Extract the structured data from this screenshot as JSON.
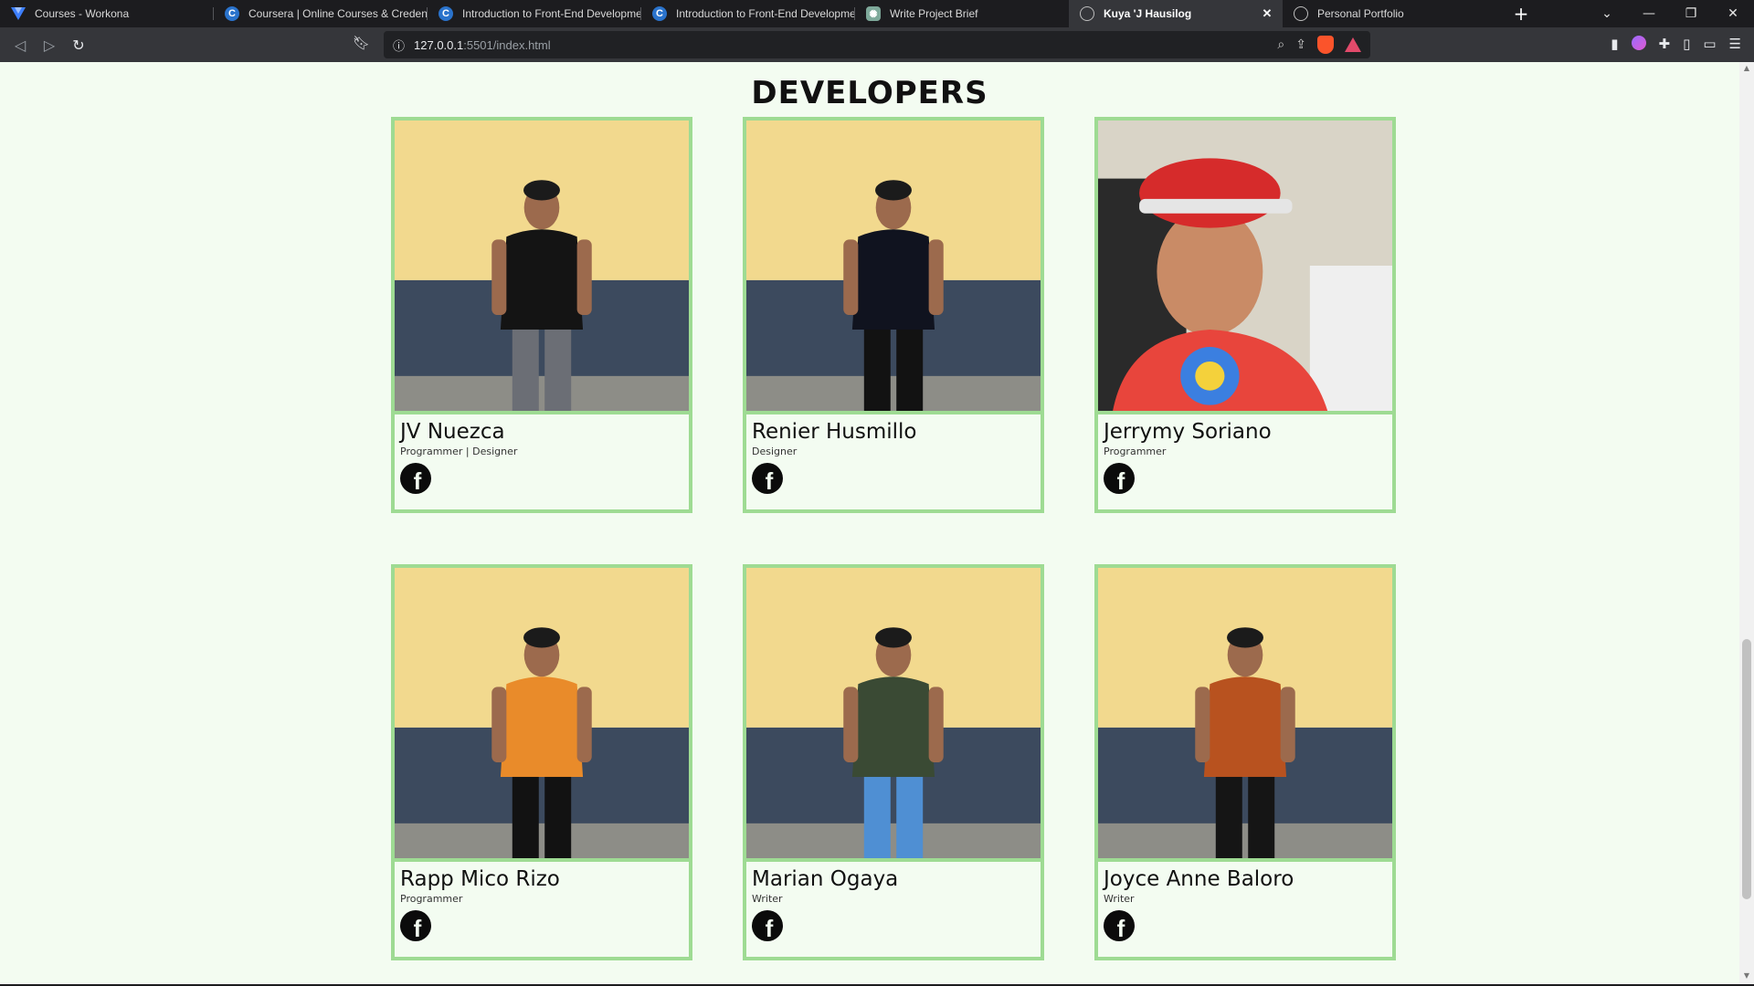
{
  "browser": {
    "tabs": [
      {
        "title": "Courses - Workona",
        "favicon": "workona-icon",
        "active": false
      },
      {
        "title": "Coursera | Online Courses & Credentials",
        "favicon": "coursera-icon",
        "active": false
      },
      {
        "title": "Introduction to Front-End Development",
        "favicon": "coursera-icon",
        "active": false
      },
      {
        "title": "Introduction to Front-End Development",
        "favicon": "coursera-icon",
        "active": false
      },
      {
        "title": "Write Project Brief",
        "favicon": "openai-icon",
        "active": false
      },
      {
        "title": "Kuya 'J Hausilog",
        "favicon": "globe-icon",
        "active": true
      },
      {
        "title": "Personal Portfolio",
        "favicon": "globe-icon",
        "active": false
      }
    ],
    "url_host": "127.0.0.1",
    "url_path": ":5501/index.html"
  },
  "page": {
    "section_title": "DEVELOPERS",
    "developers": [
      {
        "name": "JV Nuezca",
        "role": "Programmer | Designer",
        "shirt": "#141414",
        "pants": "#6b6e75"
      },
      {
        "name": "Renier Husmillo",
        "role": "Designer",
        "shirt": "#10131f",
        "pants": "#121212"
      },
      {
        "name": "Jerrymy Soriano",
        "role": "Programmer",
        "shirt": "#e8453c",
        "pants": "#121212"
      },
      {
        "name": "Rapp Mico Rizo",
        "role": "Programmer",
        "shirt": "#e98b2a",
        "pants": "#121212"
      },
      {
        "name": "Marian Ogaya",
        "role": "Writer",
        "shirt": "#3a4a34",
        "pants": "#4f8fd3"
      },
      {
        "name": "Joyce Anne Baloro",
        "role": "Writer",
        "shirt": "#b8521f",
        "pants": "#151515"
      }
    ]
  },
  "colors": {
    "page_bg": "#f3fcf1",
    "card_border": "#9edb93",
    "wall_top": "#f2d98e",
    "wall_bottom": "#3c4a5e"
  }
}
